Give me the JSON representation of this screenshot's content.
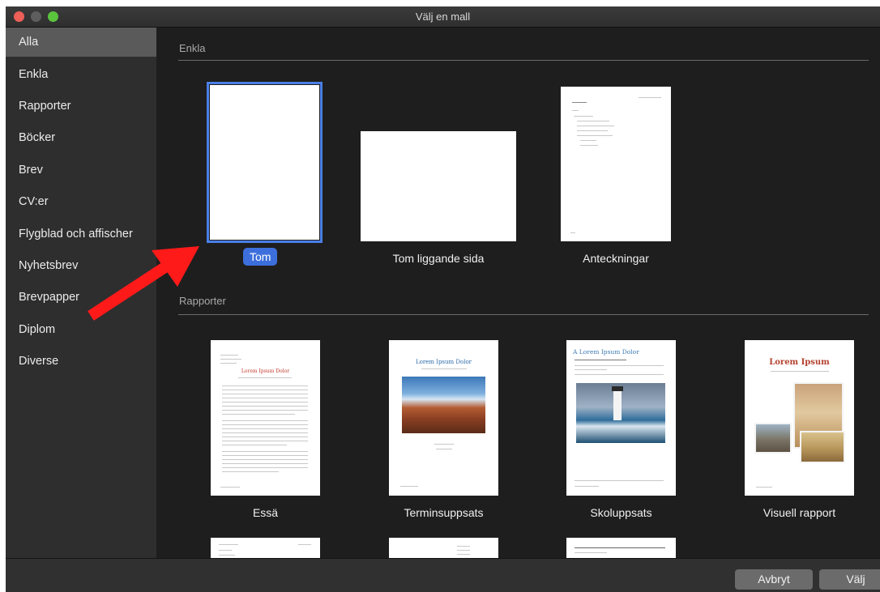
{
  "window": {
    "title": "Välj en mall"
  },
  "sidebar": {
    "items": [
      {
        "label": "Alla"
      },
      {
        "label": "Enkla"
      },
      {
        "label": "Rapporter"
      },
      {
        "label": "Böcker"
      },
      {
        "label": "Brev"
      },
      {
        "label": "CV:er"
      },
      {
        "label": "Flygblad och affischer"
      },
      {
        "label": "Nyhetsbrev"
      },
      {
        "label": "Brevpapper"
      },
      {
        "label": "Diplom"
      },
      {
        "label": "Diverse"
      }
    ],
    "selected": "Alla"
  },
  "sections": {
    "enkla": {
      "title": "Enkla",
      "templates": [
        {
          "label": "Tom",
          "selected": true
        },
        {
          "label": "Tom liggande sida"
        },
        {
          "label": "Anteckningar"
        }
      ]
    },
    "rapporter": {
      "title": "Rapporter",
      "templates": [
        {
          "label": "Essä",
          "preview_title": "Lorem Ipsum Dolor"
        },
        {
          "label": "Terminsuppsats",
          "preview_title": "Lorem Ipsum Dolor"
        },
        {
          "label": "Skoluppsats",
          "preview_title": "A Lorem Ipsum Dolor"
        },
        {
          "label": "Visuell rapport",
          "preview_title": "Lorem Ipsum"
        }
      ]
    }
  },
  "buttons": {
    "cancel": "Avbryt",
    "choose": "Välj"
  },
  "colors": {
    "accent": "#3d6fdc",
    "annotation_arrow": "#ff1a1a"
  }
}
